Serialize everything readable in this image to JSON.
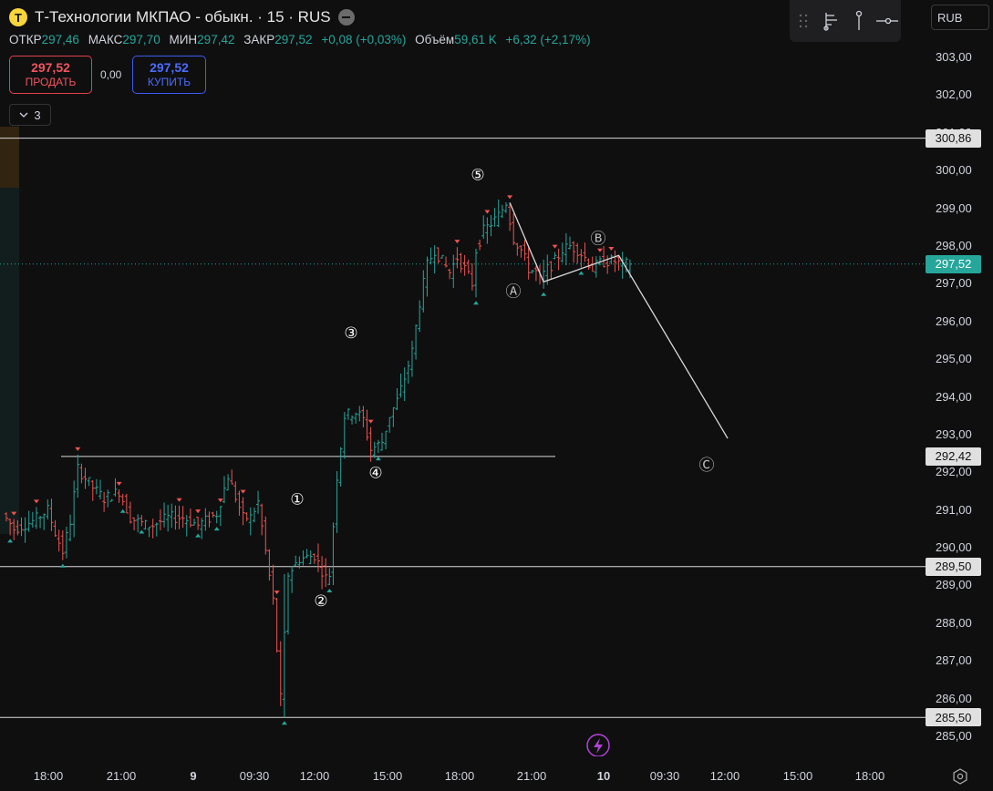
{
  "instrument": {
    "logo_letter": "T",
    "title": "Т-Технологии МКПАО - обыкн. · 15 · RUS"
  },
  "ohlc": {
    "open_label": "ОТКР",
    "open": "297,46",
    "high_label": "МАКС",
    "high": "297,70",
    "low_label": "МИН",
    "low": "297,42",
    "close_label": "ЗАКР",
    "close": "297,52",
    "change": "+0,08 (+0,03%)",
    "volume_label": "Объём",
    "volume": "59,61 K",
    "volume_change": "+6,32 (+2,17%)"
  },
  "trade": {
    "sell_price": "297,52",
    "sell_label": "ПРОДАТЬ",
    "spread": "0,00",
    "buy_price": "297,52",
    "buy_label": "КУПИТЬ"
  },
  "collapse": {
    "count": "3"
  },
  "currency": {
    "selected": "RUB"
  },
  "toolbar": {
    "icons": [
      "drag-handle-icon",
      "bar-tree-icon",
      "pin-icon",
      "horizontal-line-icon"
    ]
  },
  "colors": {
    "up": "#26a69a",
    "down": "#ef5350",
    "bg": "#0f0f10",
    "current_price_badge": "#26a69a"
  },
  "chart_data": {
    "type": "candlestick",
    "y_ticks": [
      "285,00",
      "286,00",
      "287,00",
      "288,00",
      "289,00",
      "290,00",
      "291,00",
      "292,00",
      "293,00",
      "294,00",
      "295,00",
      "296,00",
      "297,00",
      "298,00",
      "299,00",
      "300,00",
      "301,00",
      "302,00",
      "303,00"
    ],
    "y_range": [
      284.6,
      303.9
    ],
    "x_ticks": [
      {
        "label": "18:00",
        "bold": false
      },
      {
        "label": "21:00",
        "bold": false
      },
      {
        "label": "9",
        "bold": true
      },
      {
        "label": "09:30",
        "bold": false
      },
      {
        "label": "12:00",
        "bold": false
      },
      {
        "label": "15:00",
        "bold": false
      },
      {
        "label": "18:00",
        "bold": false
      },
      {
        "label": "21:00",
        "bold": false
      },
      {
        "label": "10",
        "bold": true
      },
      {
        "label": "09:30",
        "bold": false
      },
      {
        "label": "12:00",
        "bold": false
      },
      {
        "label": "15:00",
        "bold": false
      },
      {
        "label": "18:00",
        "bold": false
      }
    ],
    "horizontal_levels": [
      {
        "value": 300.86,
        "label": "300,86"
      },
      {
        "value": 292.42,
        "label": "292,42",
        "partial": true
      },
      {
        "value": 289.5,
        "label": "289,50"
      },
      {
        "value": 285.5,
        "label": "285,50"
      }
    ],
    "current_price": {
      "value": 297.52,
      "label": "297,52"
    },
    "wave_labels": [
      {
        "label": "①",
        "price": 291.3
      },
      {
        "label": "②",
        "price": 288.6
      },
      {
        "label": "③",
        "price": 295.7
      },
      {
        "label": "④",
        "price": 292.0
      },
      {
        "label": "⑤",
        "price": 299.9
      },
      {
        "label": "Ⓐ",
        "price": 296.8
      },
      {
        "label": "Ⓑ",
        "price": 298.2
      },
      {
        "label": "Ⓒ",
        "price": 292.2
      }
    ],
    "wave_path": [
      {
        "bar": 134,
        "price": 299.15
      },
      {
        "bar": 143,
        "price": 297.05
      },
      {
        "bar": 163,
        "price": 297.75
      },
      {
        "bar": 192,
        "price": 292.9
      }
    ],
    "candles": []
  }
}
